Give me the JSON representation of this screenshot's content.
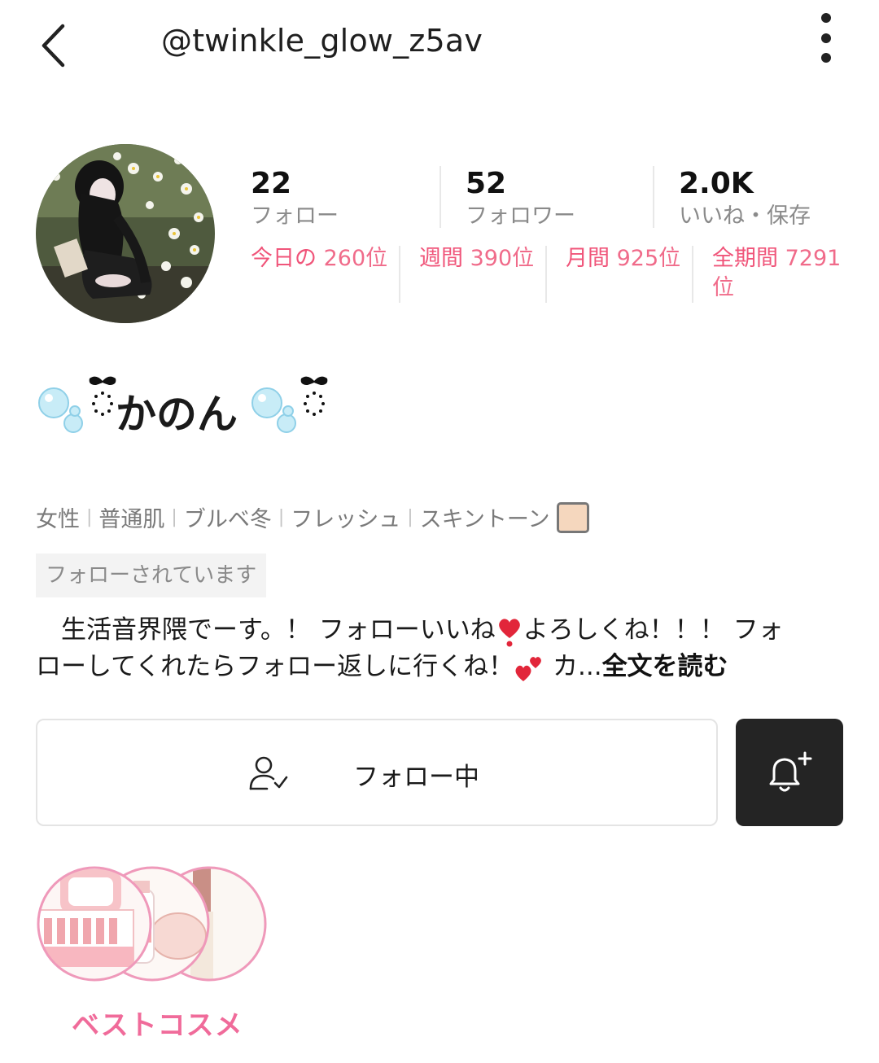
{
  "header": {
    "handle": "@twinkle_glow_z5av",
    "back_icon": "chevron-left-icon",
    "more_icon": "more-vertical-icon"
  },
  "stats": [
    {
      "value": "22",
      "label": "フォロー"
    },
    {
      "value": "52",
      "label": "フォロワー"
    },
    {
      "value": "2.0K",
      "label": "いいね・保存"
    }
  ],
  "rankings": [
    {
      "label": "今日の",
      "value": "260位"
    },
    {
      "label": "週間",
      "value": "390位"
    },
    {
      "label": "月間",
      "value": "925位"
    },
    {
      "label": "全期間",
      "value": "7291位"
    }
  ],
  "profile": {
    "nickname": "かのん",
    "tags": [
      "女性",
      "普通肌",
      "ブルベ冬",
      "フレッシュ",
      "スキントーン"
    ],
    "skin_tone_color": "#f5d7be",
    "follows_you": "フォローされています",
    "bio_line1": "　生活音界隈でーす。！ フォローいいね",
    "bio_line1b": "よろしくね！！！ フォ",
    "bio_line2": "ローしてくれたらフォロー返しに行くね！",
    "bio_line2b": " カ...",
    "read_more": "全文を読む"
  },
  "actions": {
    "following_label": "フォロー中",
    "following_icon": "user-check-icon",
    "notify_icon": "bell-plus-icon"
  },
  "collection": {
    "label": "ベストコスメ"
  },
  "colors": {
    "accent_pink": "#f0557a",
    "collection_pink": "#f06b9a",
    "dark_button": "#242424"
  }
}
